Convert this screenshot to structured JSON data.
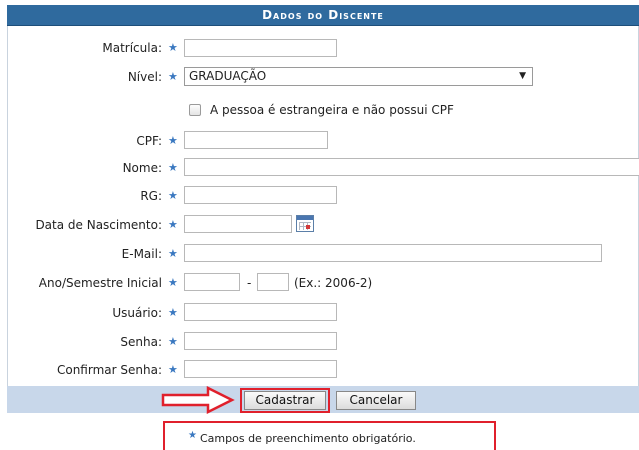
{
  "header": {
    "title": "Dados do Discente"
  },
  "form": {
    "matricula_label": "Matrícula:",
    "nivel_label": "Nível:",
    "nivel_value": "GRADUAÇÃO",
    "estrangeira_label": "A pessoa é estrangeira e não possui CPF",
    "cpf_label": "CPF:",
    "nome_label": "Nome:",
    "rg_label": "RG:",
    "nascimento_label": "Data de Nascimento:",
    "email_label": "E-Mail:",
    "ano_label": "Ano/Semestre Inicial",
    "ano_separator": "-",
    "ano_example": "(Ex.: 2006-2)",
    "usuario_label": "Usuário:",
    "senha_label": "Senha:",
    "confirmar_label": "Confirmar Senha:",
    "required_star": "★"
  },
  "buttons": {
    "cadastrar": "Cadastrar",
    "cancelar": "Cancelar"
  },
  "footer": {
    "required_note": "Campos de preenchimento obrigatório."
  },
  "colors": {
    "header_bg": "#2f6a9e",
    "button_bar_bg": "#c8d7ea",
    "highlight": "#e0202c",
    "star": "#3a78c0"
  },
  "icons": {
    "calendar": "calendar-icon",
    "arrow": "red-arrow-icon",
    "select_arrow": "chevron-down-icon"
  }
}
